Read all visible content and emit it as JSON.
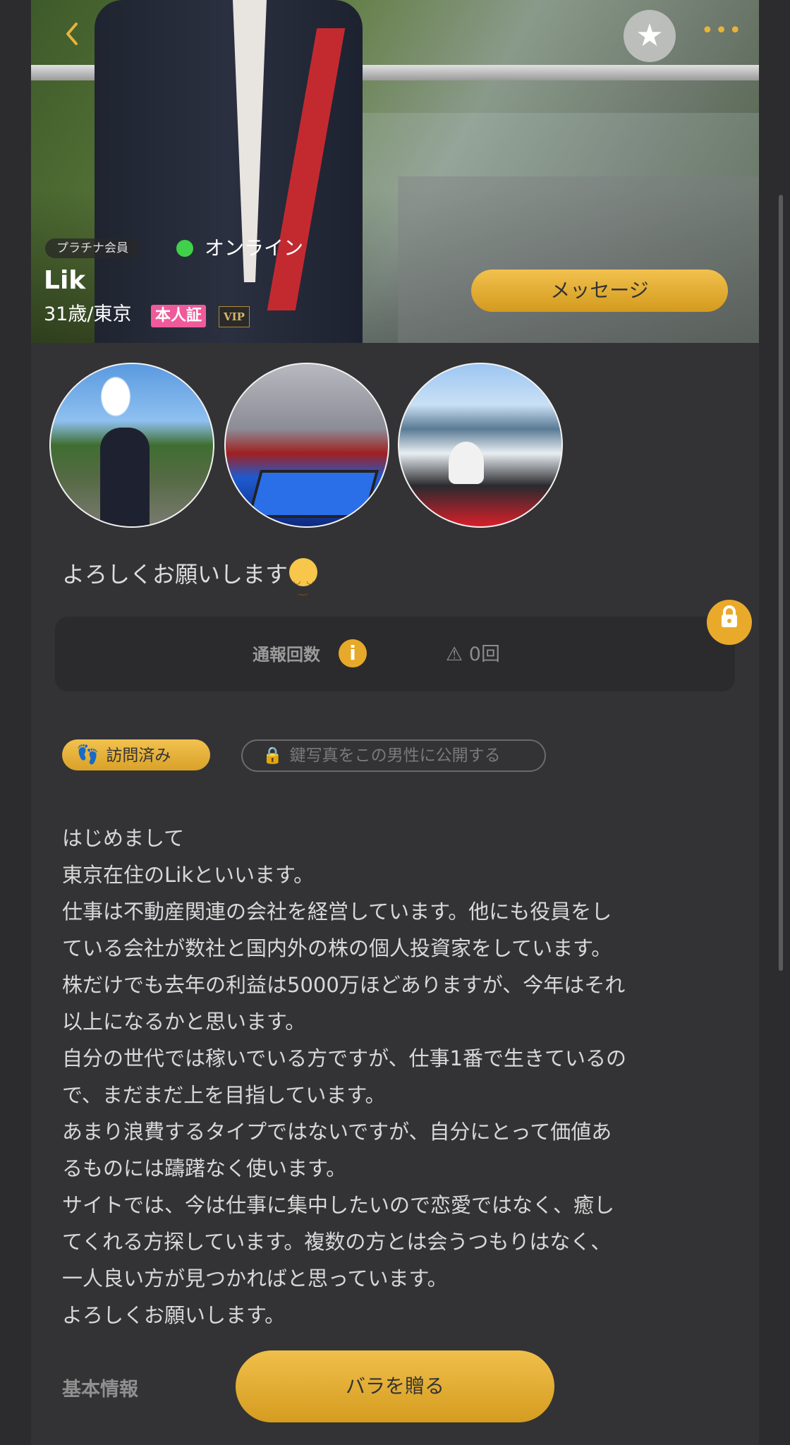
{
  "profile": {
    "membership": "プラチナ会員",
    "status": "オンライン",
    "name": "Lik",
    "age_location": "31歳/東京",
    "id_badge": "本人証",
    "vip_badge": "VIP",
    "message_button": "メッセージ",
    "greeting": "よろしくお願いします"
  },
  "header": {
    "back_icon": "chevron-left-icon",
    "favorite_icon": "star-icon",
    "more_icon": "more-horizontal-icon"
  },
  "photos": [
    {
      "name": "photo-railing"
    },
    {
      "name": "photo-billiards"
    },
    {
      "name": "photo-convertible"
    }
  ],
  "report": {
    "label": "通報回数",
    "info_glyph": "i",
    "count": "⚠ 0回"
  },
  "chips": {
    "visited": "訪問済み",
    "key_photo": "鍵写真をこの男性に公開する"
  },
  "bio_lines": [
    "はじめまして",
    "東京在住のLikといいます。",
    "仕事は不動産関連の会社を経営しています。他にも役員をし",
    "ている会社が数社と国内外の株の個人投資家をしています。",
    "株だけでも去年の利益は5000万ほどありますが、今年はそれ",
    "以上になるかと思います。",
    "自分の世代では稼いでいる方ですが、仕事1番で生きているの",
    "で、まだまだ上を目指しています。",
    "あまり浪費するタイプではないですが、自分にとって価値あ",
    "るものには躊躇なく使います。",
    "サイトでは、今は仕事に集中したいので恋愛ではなく、癒し",
    "てくれる方探しています。複数の方とは会うつもりはなく、",
    "一人良い方が見つかればと思っています。",
    "よろしくお願いします。"
  ],
  "footer": {
    "basic_info_label": "基本情報",
    "rose_button": "バラを贈る"
  },
  "colors": {
    "accent": "#e6a92a",
    "online": "#3fd14a",
    "id_badge": "#ef5b9a",
    "background": "#333335"
  }
}
